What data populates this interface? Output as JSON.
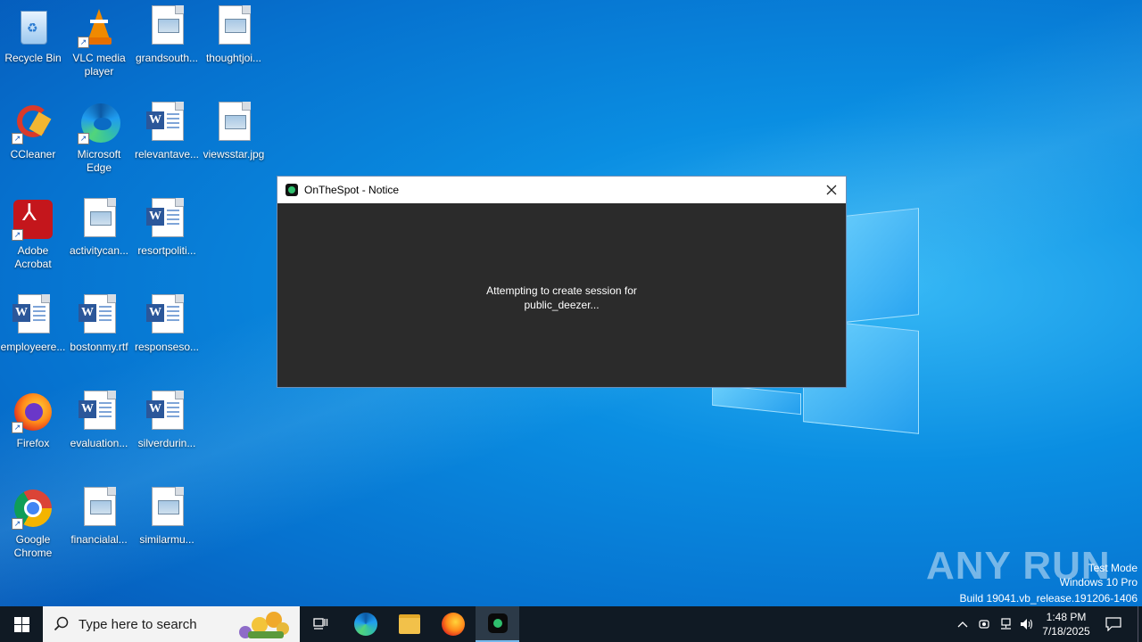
{
  "desktop": {
    "icons": [
      {
        "label": "Recycle Bin"
      },
      {
        "label": "VLC media player"
      },
      {
        "label": "grandsouth..."
      },
      {
        "label": "thoughtjoi..."
      },
      {
        "label": "CCleaner"
      },
      {
        "label": "Microsoft Edge"
      },
      {
        "label": "relevantave..."
      },
      {
        "label": "viewsstar.jpg"
      },
      {
        "label": "Adobe Acrobat"
      },
      {
        "label": "activitycan..."
      },
      {
        "label": "resortpoliti..."
      },
      {
        "label": "employeere..."
      },
      {
        "label": "bostonmy.rtf"
      },
      {
        "label": "responseso..."
      },
      {
        "label": "Firefox"
      },
      {
        "label": "evaluation..."
      },
      {
        "label": "silverdurin..."
      },
      {
        "label": "Google Chrome"
      },
      {
        "label": "financialal..."
      },
      {
        "label": "similarmu..."
      }
    ]
  },
  "dialog": {
    "title": "OnTheSpot - Notice",
    "message_line1": "Attempting to create session for",
    "message_line2": "public_deezer..."
  },
  "watermark": {
    "brand": "ANY RUN",
    "line1": "Test Mode",
    "line2": "Windows 10 Pro",
    "line3": "Build 19041.vb_release.191206-1406"
  },
  "taskbar": {
    "search_placeholder": "Type here to search",
    "time": "1:48 PM",
    "date": "7/18/2025"
  },
  "colors": {
    "accent": "#0a8ee2",
    "dialog_bg": "#2b2b2b",
    "taskbar_bg": "#101a24"
  }
}
